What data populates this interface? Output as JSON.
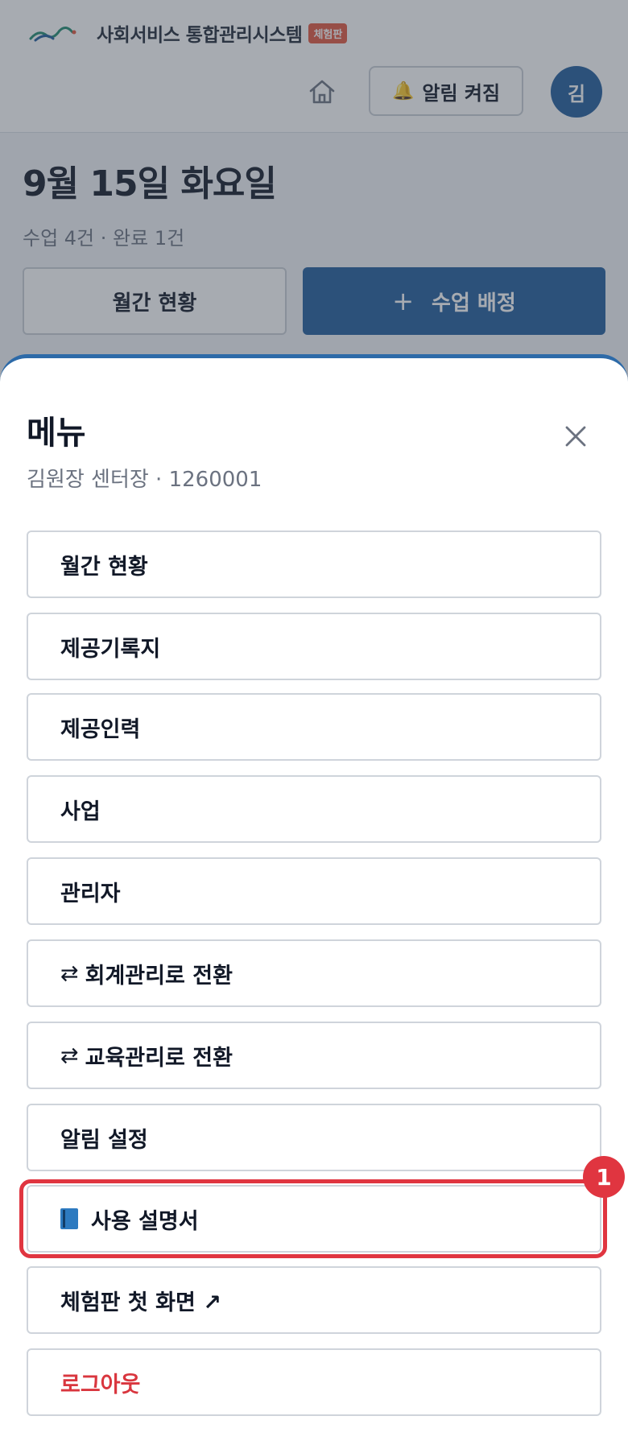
{
  "app": {
    "brand_name": "사회서비스 통합관리시스템",
    "brand_badge": "체험판",
    "alert_label": "알림 켜짐",
    "avatar_initial": "김",
    "date_title": "9월 15일 화요일",
    "date_sub": "수업 4건 · 완료 1건",
    "monthly_button": "월간 현황",
    "assign_plus": "+",
    "assign_button": "수업 배정"
  },
  "menu": {
    "title": "메뉴",
    "subtitle": "김원장 센터장 · 1260001",
    "items": [
      {
        "label": "월간 현황"
      },
      {
        "label": "제공기록지"
      },
      {
        "label": "제공인력"
      },
      {
        "label": "사업"
      },
      {
        "label": "관리자"
      },
      {
        "glyph": "⇄",
        "label": "회계관리로 전환"
      },
      {
        "glyph": "⇄",
        "label": "교육관리로 전환"
      },
      {
        "label": "알림 설정"
      },
      {
        "label": "사용 설명서"
      },
      {
        "label": "체험판 첫 화면 ↗"
      },
      {
        "label": "로그아웃"
      }
    ]
  },
  "annotation": {
    "marker_number": "1"
  },
  "colors": {
    "primary": "#1f5b9c",
    "highlight": "#e03540",
    "danger": "#d9363e",
    "badge": "#e2573f"
  },
  "icons": [
    "home-icon",
    "bell-icon",
    "close-icon",
    "switch-icon",
    "book-icon",
    "external-link-icon"
  ]
}
